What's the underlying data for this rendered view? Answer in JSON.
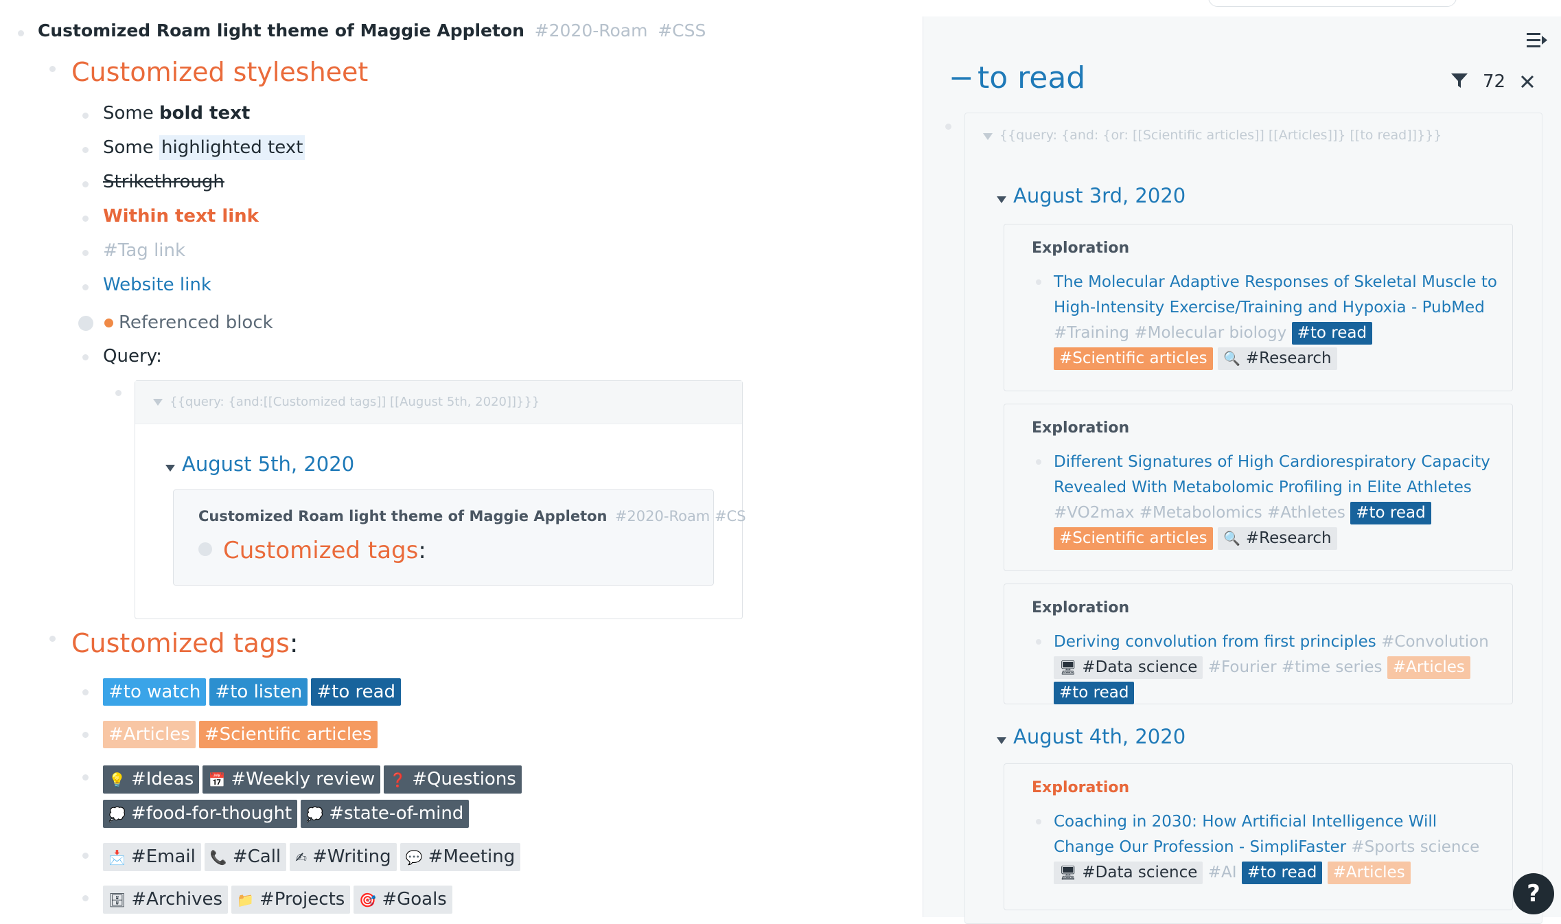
{
  "main": {
    "title": "Customized Roam light theme of Maggie Appleton",
    "title_tags": [
      "#2020-Roam",
      "#CSS"
    ],
    "stylesheet_heading": "Customized stylesheet",
    "items": {
      "bold_prefix": "Some ",
      "bold_text": "bold text",
      "highlight_prefix": "Some ",
      "highlight_text": "highlighted text",
      "strikethrough": "Strikethrough",
      "within_link": "Within text link",
      "tag_link": "#Tag link",
      "website_link": "Website link",
      "referenced_block": "Referenced block",
      "query_label": "Query:"
    },
    "query": {
      "text": "{{query:  {and:[[Customized tags]] [[August 5th, 2020]]}}}",
      "date": "August 5th, 2020",
      "card_title": "Customized Roam light theme of Maggie Appleton",
      "card_tags": "#2020-Roam  #CS",
      "card_heading": "Customized tags",
      "card_colon": ":"
    },
    "tags_heading": "Customized tags",
    "tags_colon": ":",
    "tags": {
      "watch": "#to watch",
      "listen": "#to listen",
      "read": "#to read",
      "articles": "#Articles",
      "sci": "#Scientific articles",
      "ideas": "#Ideas",
      "weekly": "#Weekly review",
      "questions": "#Questions",
      "food": "#food-for-thought",
      "mind": "#state-of-mind",
      "email": "#Email",
      "call": "#Call",
      "writing": "#Writing",
      "meeting": "#Meeting",
      "archives": "#Archives",
      "projects": "#Projects",
      "goals": "#Goals"
    },
    "tag_icons": {
      "ideas": "💡",
      "weekly": "📅",
      "questions": "❓",
      "food": "💭",
      "mind": "💭",
      "email": "📩",
      "call": "📞",
      "writing": "✍",
      "meeting": "💬",
      "archives": "🗄",
      "projects": "📁",
      "goals": "🎯"
    }
  },
  "sidebar": {
    "title_prefix": "−",
    "title": "to read",
    "count": "72",
    "query_text": "{{query:  {and: {or: [[Scientific articles]] [[Articles]]} [[to read]]}}}",
    "date1": "August 3rd, 2020",
    "date2": "August 4th, 2020",
    "card_label": "Exploration",
    "cards": [
      {
        "link": "The Molecular Adaptive Responses of Skeletal Muscle to High-Intensity Exercise/Training and Hypoxia - PubMed",
        "muted1": "#Training",
        "muted2": "#Molecular biology",
        "read": "#to read",
        "sci": "#Scientific articles",
        "research": "#Research"
      },
      {
        "link": "Different Signatures of High Cardiorespiratory Capacity Revealed With Metabolomic Profiling in Elite Athletes",
        "muted1": "#VO2max",
        "muted2": "#Metabolomics",
        "muted3": "#Athletes",
        "read": "#to read",
        "sci": "#Scientific articles",
        "research": "#Research"
      },
      {
        "link": "Deriving convolution from first principles",
        "muted1": "#Convolution",
        "datasci": "#Data science",
        "muted2": "#Fourier",
        "muted3": "#time series",
        "articles": "#Articles",
        "read": "#to read"
      },
      {
        "link": "Coaching in 2030: How Artificial Intelligence Will Change Our Profession - SimpliFaster",
        "muted1": "#Sports science",
        "datasci": "#Data science",
        "muted2": "#AI",
        "read": "#to read",
        "articles": "#Articles"
      }
    ],
    "help": "?"
  },
  "colors": {
    "accent_orange": "#ea6b3b",
    "link_blue": "#1f7ab8",
    "to_read": "#18639c",
    "to_watch": "#3aa4e8",
    "sci_articles": "#f59a60",
    "articles": "#f8c6a4"
  }
}
